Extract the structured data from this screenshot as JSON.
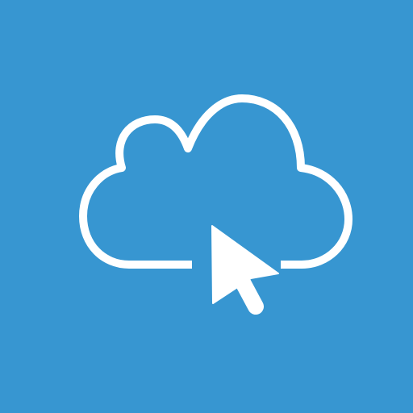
{
  "icon": {
    "name": "cloud-cursor-icon",
    "parts": [
      "cloud-outline-icon",
      "mouse-pointer-icon"
    ]
  },
  "colors": {
    "background": "#3796D1",
    "foreground": "#FFFFFF"
  }
}
